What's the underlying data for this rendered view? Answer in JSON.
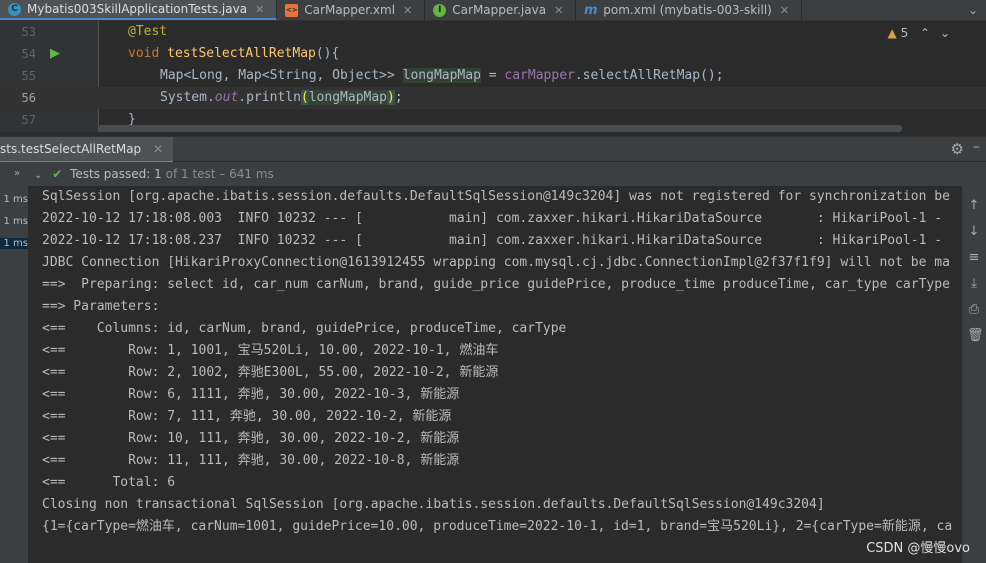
{
  "tabs": [
    {
      "label": "Mybatis003SkillApplicationTests.java",
      "icon": "C",
      "icon_color": "#3592c4",
      "active": true
    },
    {
      "label": "CarMapper.xml",
      "icon": "xml",
      "icon_color": "#e8743b"
    },
    {
      "label": "CarMapper.java",
      "icon": "I",
      "icon_color": "#62b543"
    },
    {
      "label": "pom.xml (mybatis-003-skill)",
      "icon": "m",
      "icon_color": "#4a88c7"
    }
  ],
  "editor": {
    "warning_count": "5",
    "lines": [
      {
        "num": "53",
        "text": "@Test"
      },
      {
        "num": "54",
        "text": "void testSelectAllRetMap(){"
      },
      {
        "num": "55",
        "text": "Map<Long, Map<String, Object>> longMapMap = carMapper.selectAllRetMap();"
      },
      {
        "num": "56",
        "text": "System.out.println(longMapMap);"
      },
      {
        "num": "57",
        "text": "}"
      }
    ]
  },
  "run": {
    "tab_label": "sts.testSelectAllRetMap",
    "status_passed": "Tests passed: 1",
    "status_detail": "of 1 test – 641 ms",
    "tree_items": [
      "1 ms",
      "1 ms",
      "1 ms"
    ]
  },
  "console": {
    "lines": [
      "SqlSession [org.apache.ibatis.session.defaults.DefaultSqlSession@149c3204] was not registered for synchronization be",
      "2022-10-12 17:18:08.003  INFO 10232 --- [           main] com.zaxxer.hikari.HikariDataSource       : HikariPool-1 -",
      "2022-10-12 17:18:08.237  INFO 10232 --- [           main] com.zaxxer.hikari.HikariDataSource       : HikariPool-1 -",
      "JDBC Connection [HikariProxyConnection@1613912455 wrapping com.mysql.cj.jdbc.ConnectionImpl@2f37f1f9] will not be ma",
      "==>  Preparing: select id, car_num carNum, brand, guide_price guidePrice, produce_time produceTime, car_type carType",
      "==> Parameters: ",
      "<==    Columns: id, carNum, brand, guidePrice, produceTime, carType",
      "<==        Row: 1, 1001, 宝马520Li, 10.00, 2022-10-1, 燃油车",
      "<==        Row: 2, 1002, 奔驰E300L, 55.00, 2022-10-2, 新能源",
      "<==        Row: 6, 1111, 奔驰, 30.00, 2022-10-3, 新能源",
      "<==        Row: 7, 111, 奔驰, 30.00, 2022-10-2, 新能源",
      "<==        Row: 10, 111, 奔驰, 30.00, 2022-10-2, 新能源",
      "<==        Row: 11, 111, 奔驰, 30.00, 2022-10-8, 新能源",
      "<==      Total: 6",
      "Closing non transactional SqlSession [org.apache.ibatis.session.defaults.DefaultSqlSession@149c3204]",
      "{1={carType=燃油车, carNum=1001, guidePrice=10.00, produceTime=2022-10-1, id=1, brand=宝马520Li}, 2={carType=新能源, ca"
    ]
  },
  "watermark": "CSDN @慢慢ovo"
}
